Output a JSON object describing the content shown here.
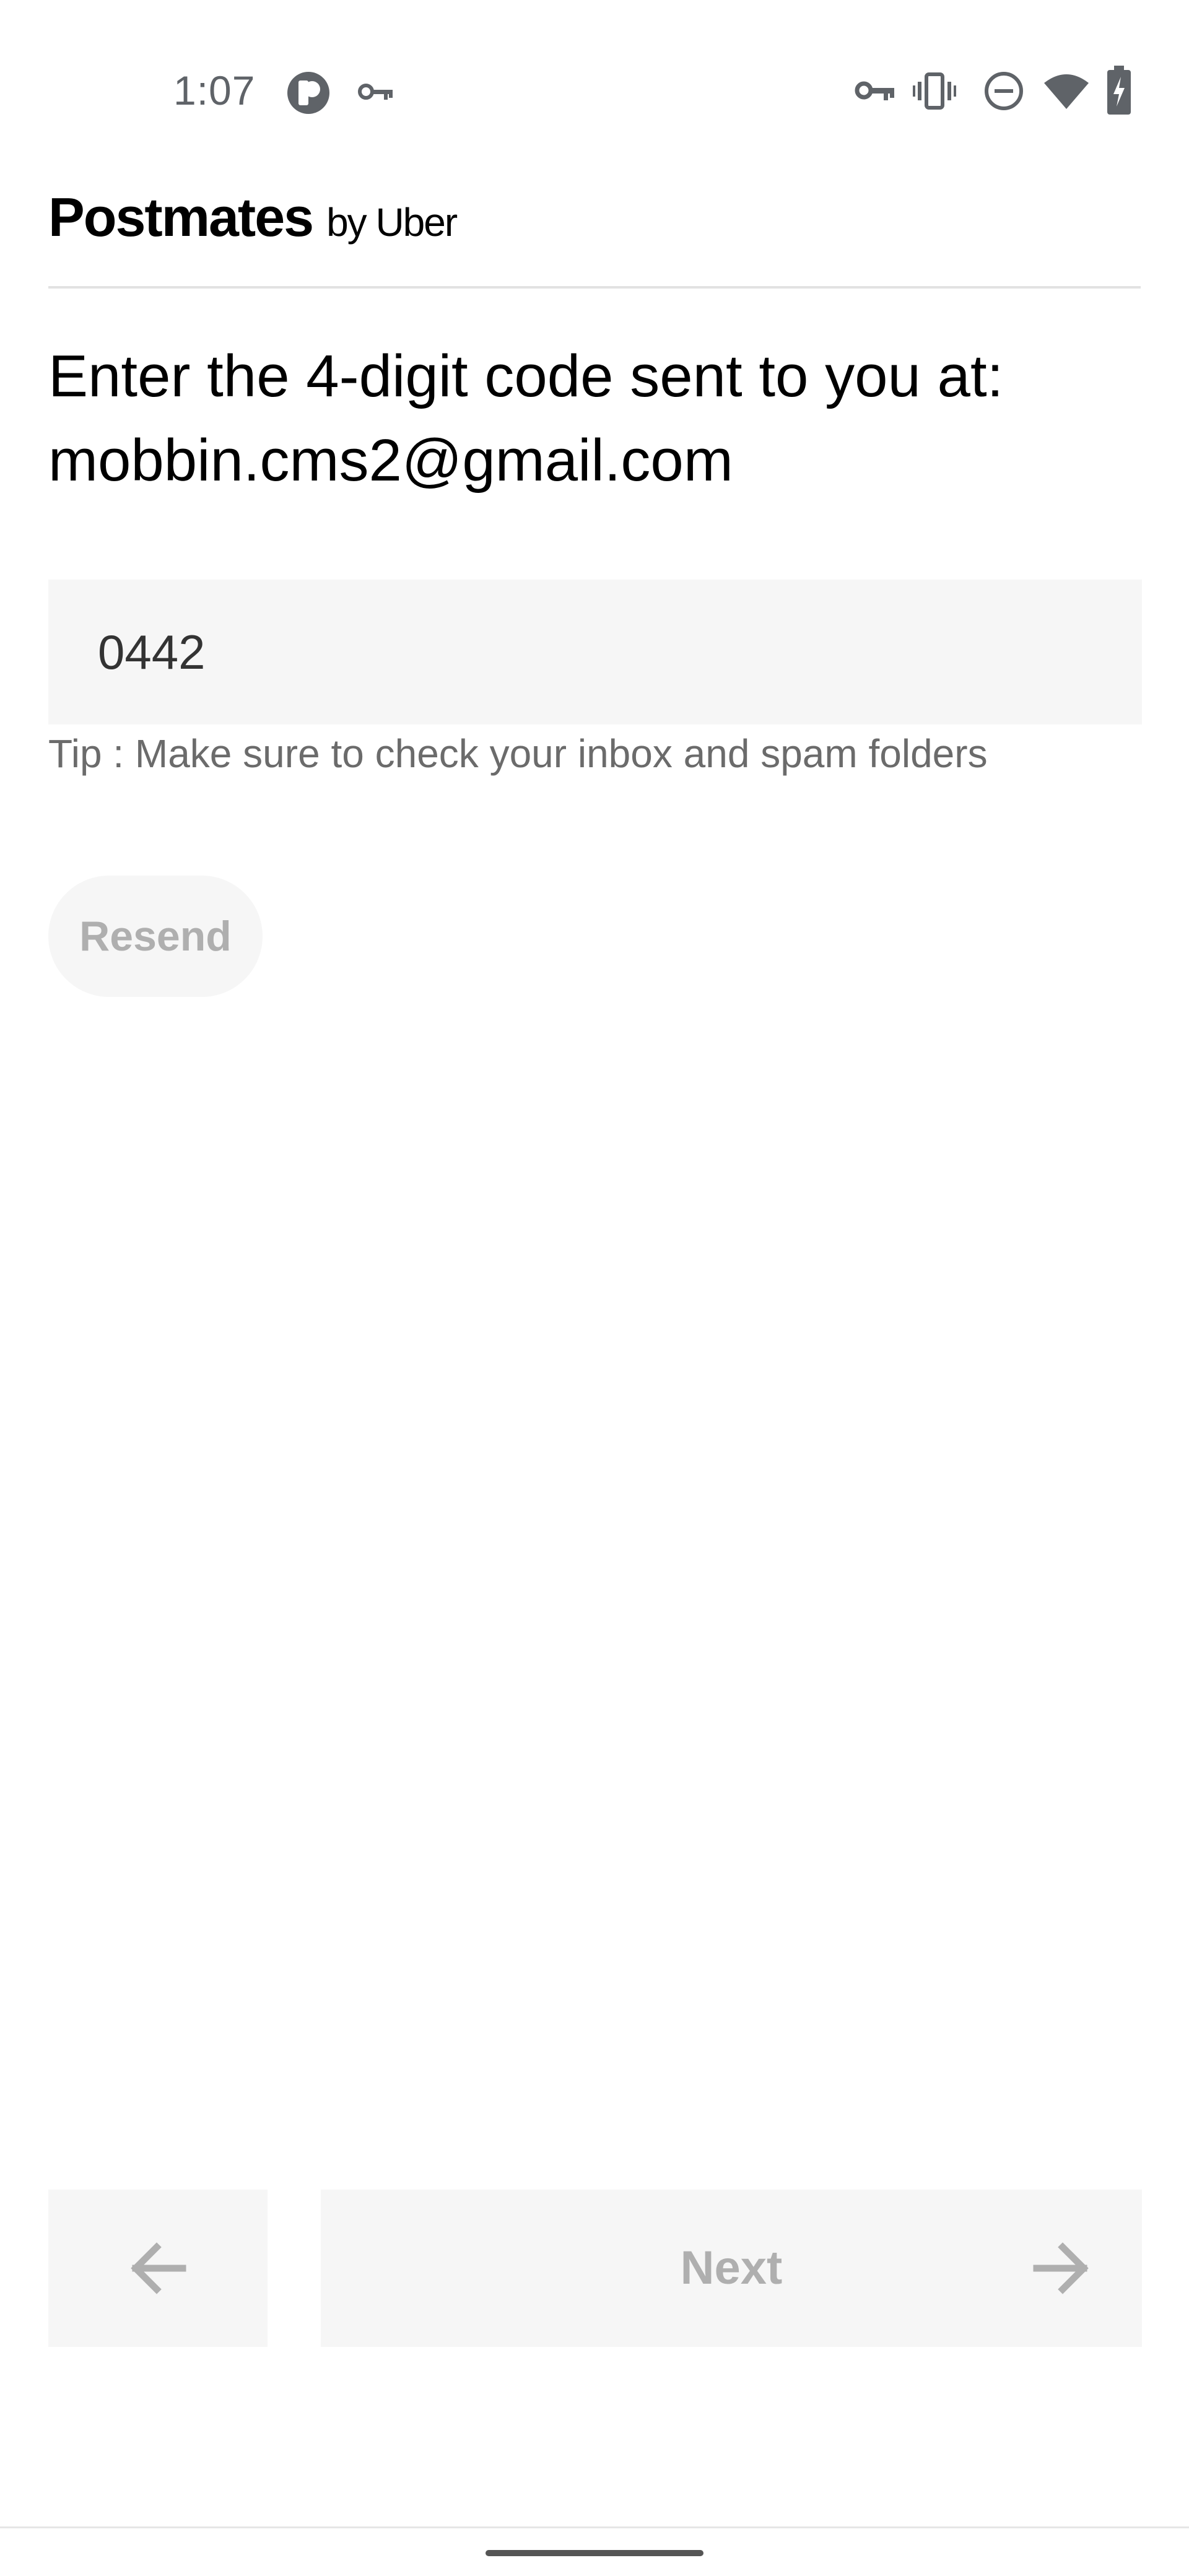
{
  "status_bar": {
    "time": "1:07",
    "left_icons": [
      "app-notification-icon",
      "vpn-key-icon"
    ],
    "right_icons": [
      "vpn-key-icon",
      "vibrate-icon",
      "do-not-disturb-icon",
      "wifi-icon",
      "battery-charging-icon"
    ],
    "icon_color": "#5f6368"
  },
  "header": {
    "brand": "Postmates",
    "brand_suffix": "by Uber"
  },
  "verification": {
    "prompt_line_1": "Enter the 4-digit code sent to you at:",
    "prompt_line_2": "mobbin.cms2@gmail.com",
    "code_value": "0442",
    "tip": "Tip : Make sure to check your inbox and spam folders",
    "resend_label": "Resend"
  },
  "footer": {
    "back_icon": "arrow-left-icon",
    "next_label": "Next",
    "next_icon": "arrow-right-icon"
  },
  "colors": {
    "background": "#ffffff",
    "field_background": "#f6f6f6",
    "disabled_text": "#afafaf",
    "tip_text": "#6b6b6b"
  }
}
